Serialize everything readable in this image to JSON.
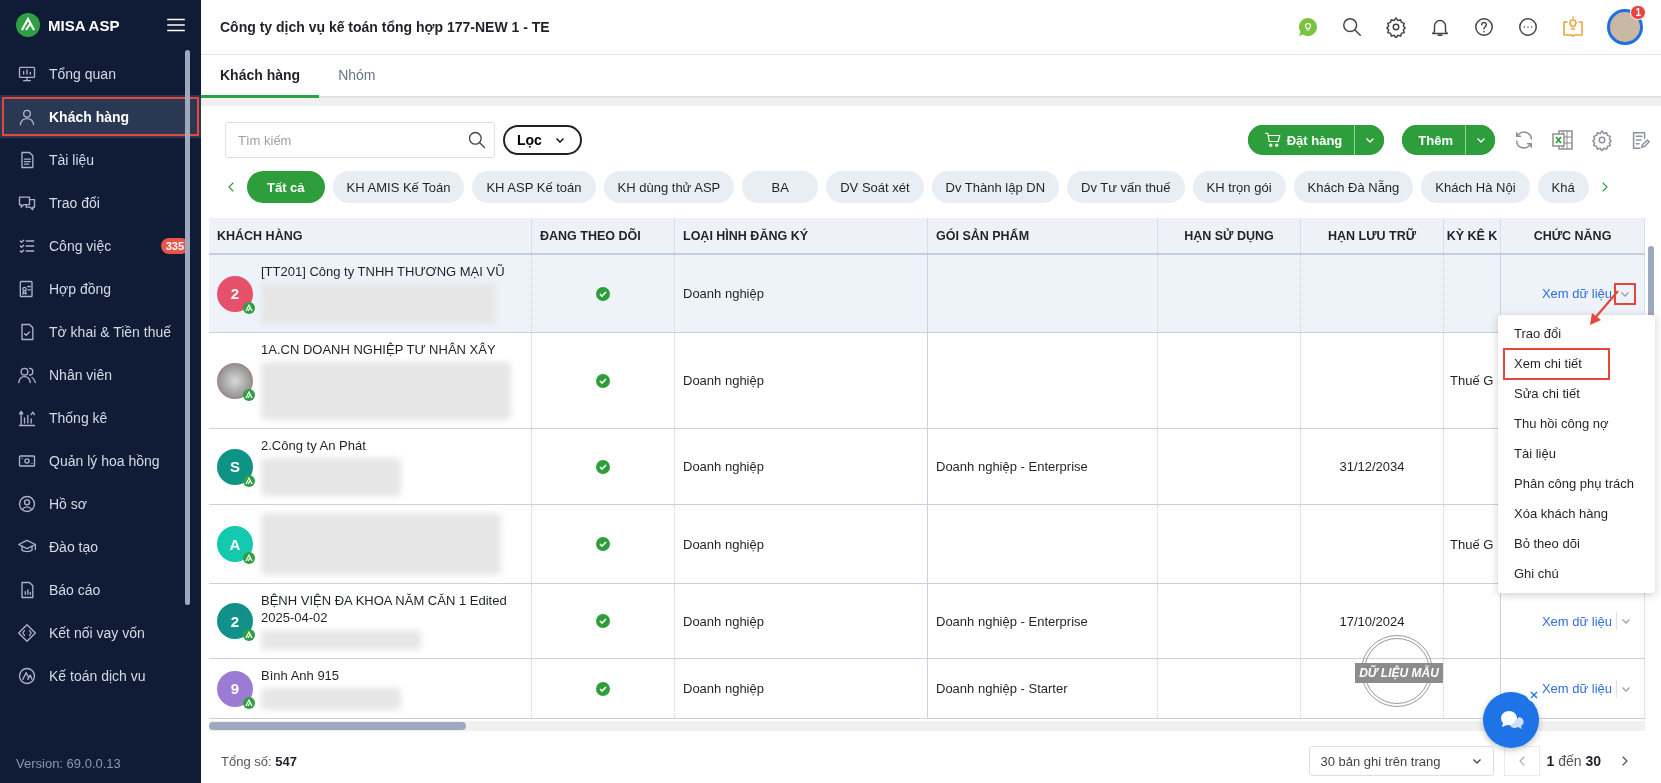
{
  "sidebar": {
    "brand": "MISA ASP",
    "items": [
      {
        "label": "Tổng quan",
        "selected": false,
        "annotated": false
      },
      {
        "label": "Khách hàng",
        "selected": true,
        "annotated": true
      },
      {
        "label": "Tài liệu",
        "selected": false,
        "annotated": false
      },
      {
        "label": "Trao đổi",
        "selected": false,
        "annotated": false
      },
      {
        "label": "Công việc",
        "selected": false,
        "annotated": false,
        "badge": "335"
      },
      {
        "label": "Hợp đồng",
        "selected": false,
        "annotated": false
      },
      {
        "label": "Tờ khai & Tiền thuế",
        "selected": false,
        "annotated": false
      },
      {
        "label": "Nhân viên",
        "selected": false,
        "annotated": false
      },
      {
        "label": "Thống kê",
        "selected": false,
        "annotated": false
      },
      {
        "label": "Quản lý hoa hồng",
        "selected": false,
        "annotated": false
      },
      {
        "label": "Hồ sơ",
        "selected": false,
        "annotated": false
      },
      {
        "label": "Đào tạo",
        "selected": false,
        "annotated": false
      },
      {
        "label": "Báo cáo",
        "selected": false,
        "annotated": false
      },
      {
        "label": "Kết nối vay vốn",
        "selected": false,
        "annotated": false
      },
      {
        "label": "Kế toán dịch vu",
        "selected": false,
        "annotated": false
      }
    ],
    "version": "Version: 69.0.0.13"
  },
  "header": {
    "title": "Công ty dịch vụ kế toán tổng hợp 177-NEW 1 - TE",
    "notification_count": "1"
  },
  "tabs": [
    {
      "label": "Khách hàng",
      "selected": true
    },
    {
      "label": "Nhóm",
      "selected": false
    }
  ],
  "toolbar": {
    "search": {
      "placeholder": "Tìm kiếm"
    },
    "filter": "Lọc",
    "order_button": "Đặt hàng",
    "add_button": "Thêm"
  },
  "chips": [
    {
      "label": "Tất cả",
      "selected": true
    },
    {
      "label": "KH AMIS Kế Toán",
      "selected": false
    },
    {
      "label": "KH ASP Kế toán",
      "selected": false
    },
    {
      "label": "KH dùng thử ASP",
      "selected": false
    },
    {
      "label": "BA",
      "selected": false
    },
    {
      "label": "DV Soát xét",
      "selected": false
    },
    {
      "label": "Dv Thành lập DN",
      "selected": false
    },
    {
      "label": "Dv Tư vấn thuế",
      "selected": false
    },
    {
      "label": "KH trọn gói",
      "selected": false
    },
    {
      "label": "Khách Đà Nẵng",
      "selected": false
    },
    {
      "label": "Khách Hà Nội",
      "selected": false
    },
    {
      "label": "Khá",
      "selected": false
    }
  ],
  "table": {
    "columns": [
      "KHÁCH HÀNG",
      "ĐANG THEO DÕI",
      "LOẠI HÌNH ĐĂNG KÝ",
      "GÓI SẢN PHẨM",
      "HẠN SỬ DỤNG",
      "HẠN LƯU TRỮ",
      "KỲ KÊ K",
      "CHỨC NĂNG"
    ],
    "rows": [
      {
        "selected": true,
        "avatar": {
          "kind": "letter",
          "letter": "2",
          "color": "#e5506a"
        },
        "name": "[TT201] Công ty TNHH THƯƠNG MẠI VŨ",
        "following": true,
        "registration": "Doanh nghiệp",
        "action": "Xem dữ liệu",
        "caret_annotated": true
      },
      {
        "selected": false,
        "avatar": {
          "kind": "photo"
        },
        "name": "1A.CN DOANH NGHIỆP TƯ NHÂN XÂY",
        "following": true,
        "registration": "Doanh nghiệp",
        "period": "Thuế G"
      },
      {
        "selected": false,
        "avatar": {
          "kind": "letter",
          "letter": "S",
          "color": "#0f9384"
        },
        "name": "2.Công ty An Phát",
        "following": true,
        "registration": "Doanh nghiệp",
        "package": "Doanh nghiệp - Enterprise",
        "storage_until": "31/12/2034"
      },
      {
        "selected": false,
        "avatar": {
          "kind": "letter",
          "letter": "A",
          "color": "#14c9ae"
        },
        "following": true,
        "registration": "Doanh nghiệp",
        "period": "Thuế G"
      },
      {
        "selected": false,
        "avatar": {
          "kind": "letter",
          "letter": "2",
          "color": "#11918a"
        },
        "name": "BỆNH VIỆN ĐA KHOA NĂM CĂN 1 Edited 2025-04-02",
        "following": true,
        "registration": "Doanh nghiệp",
        "package": "Doanh nghiệp - Enterprise",
        "storage_until": "17/10/2024",
        "action": "Xem dữ liệu",
        "caret_annotated": false
      },
      {
        "selected": false,
        "avatar": {
          "kind": "letter",
          "letter": "9",
          "color": "#9b7bd3"
        },
        "name": "Bình Anh 915",
        "following": true,
        "registration": "Doanh nghiệp",
        "package": "Doanh nghiệp - Starter",
        "action": "Xem dữ liệu",
        "caret_annotated": false
      }
    ]
  },
  "menu": {
    "items": [
      {
        "label": "Trao đổi",
        "annotated": false
      },
      {
        "label": "Xem chi tiết",
        "annotated": true
      },
      {
        "label": "Sửa chi tiết",
        "annotated": false
      },
      {
        "label": "Thu hồi công nợ",
        "annotated": false
      },
      {
        "label": "Tài liệu",
        "annotated": false
      },
      {
        "label": "Phân công phụ trách",
        "annotated": false
      },
      {
        "label": "Xóa khách hàng",
        "annotated": false
      },
      {
        "label": "Bỏ theo dõi",
        "annotated": false
      },
      {
        "label": "Ghi chú",
        "annotated": false
      }
    ]
  },
  "stamp": "DỮ LIỆU MẪU",
  "footer": {
    "total_label": "Tổng số:",
    "total": "547",
    "page_size": "30 bản ghi trên trang",
    "page_from": "1",
    "page_word": "đến",
    "page_to": "30"
  }
}
